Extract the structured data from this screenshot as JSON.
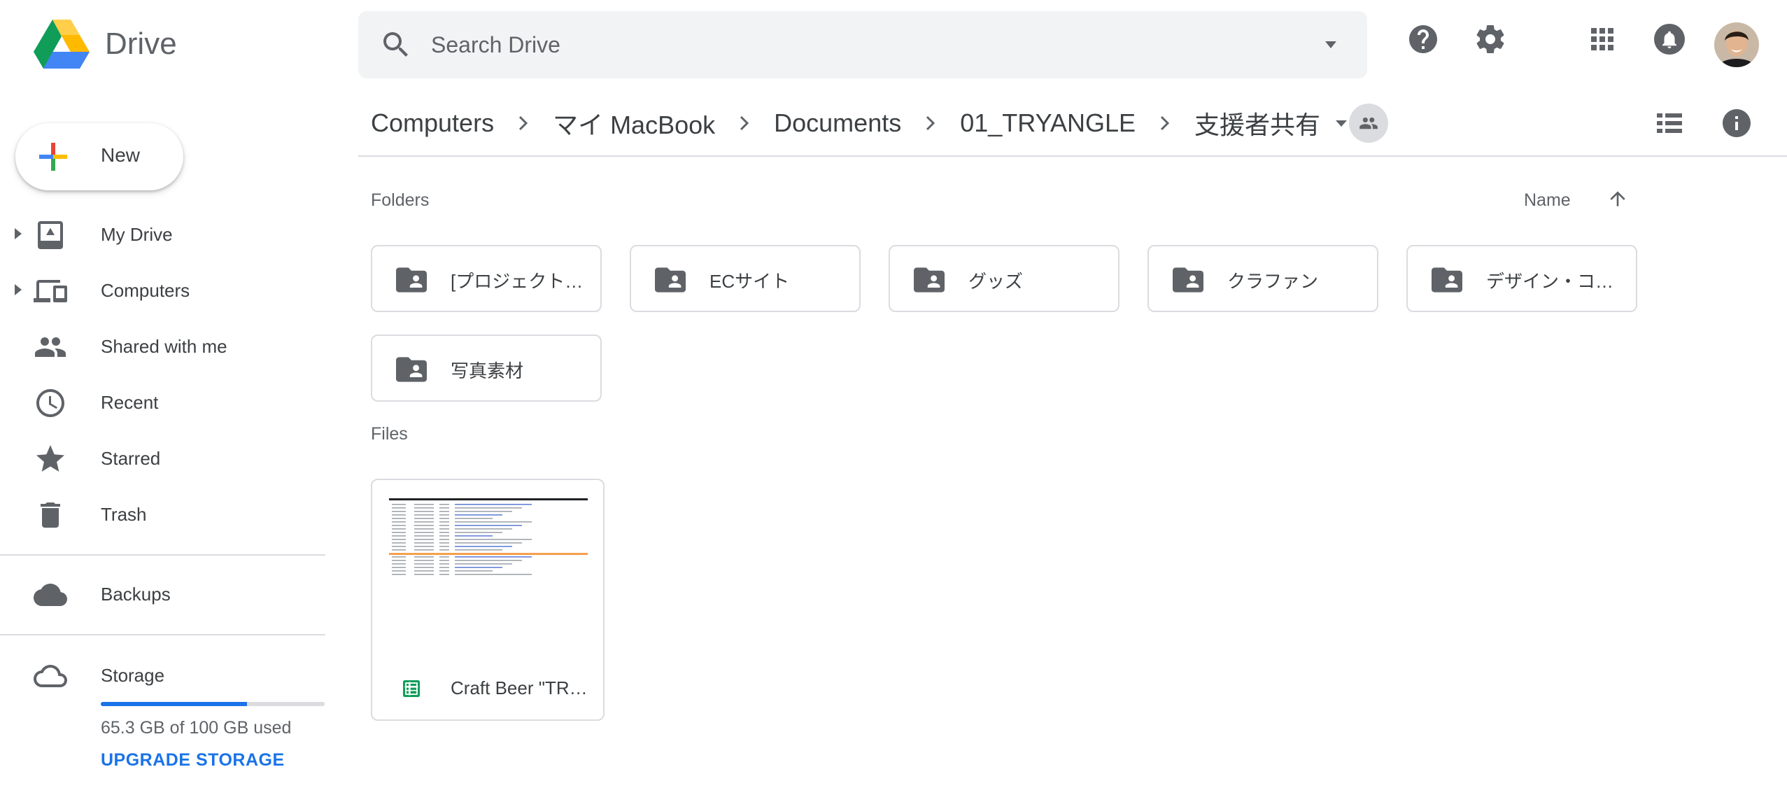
{
  "app": {
    "brand": "Drive"
  },
  "search": {
    "placeholder": "Search Drive"
  },
  "header_icons": [
    "help-icon",
    "settings-icon",
    "apps-icon",
    "notifications-icon"
  ],
  "sidebar": {
    "new_label": "New",
    "items": [
      {
        "label": "My Drive",
        "icon": "my-drive-icon",
        "expandable": true
      },
      {
        "label": "Computers",
        "icon": "computers-icon",
        "expandable": true
      },
      {
        "label": "Shared with me",
        "icon": "people-icon",
        "expandable": false
      },
      {
        "label": "Recent",
        "icon": "clock-icon",
        "expandable": false
      },
      {
        "label": "Starred",
        "icon": "star-icon",
        "expandable": false
      },
      {
        "label": "Trash",
        "icon": "trash-icon",
        "expandable": false
      }
    ],
    "backups_label": "Backups",
    "storage": {
      "label": "Storage",
      "used_text": "65.3 GB of 100 GB used",
      "used_fraction": 0.653,
      "upgrade_label": "UPGRADE STORAGE"
    }
  },
  "breadcrumb": [
    "Computers",
    "マイ MacBook",
    "Documents",
    "01_TRYANGLE",
    "支援者共有"
  ],
  "content": {
    "folders_label": "Folders",
    "sort_label": "Name",
    "files_label": "Files",
    "folders": [
      "[プロジェクト…",
      "ECサイト",
      "グッズ",
      "クラファン",
      "デザイン・コ…",
      "写真素材"
    ],
    "files": [
      {
        "name": "Craft Beer \"TR…",
        "type": "spreadsheet"
      }
    ]
  },
  "colors": {
    "accent": "#1a73e8",
    "sheets_green": "#0f9d58",
    "icon_gray": "#5f6368",
    "border": "#dadce0"
  }
}
